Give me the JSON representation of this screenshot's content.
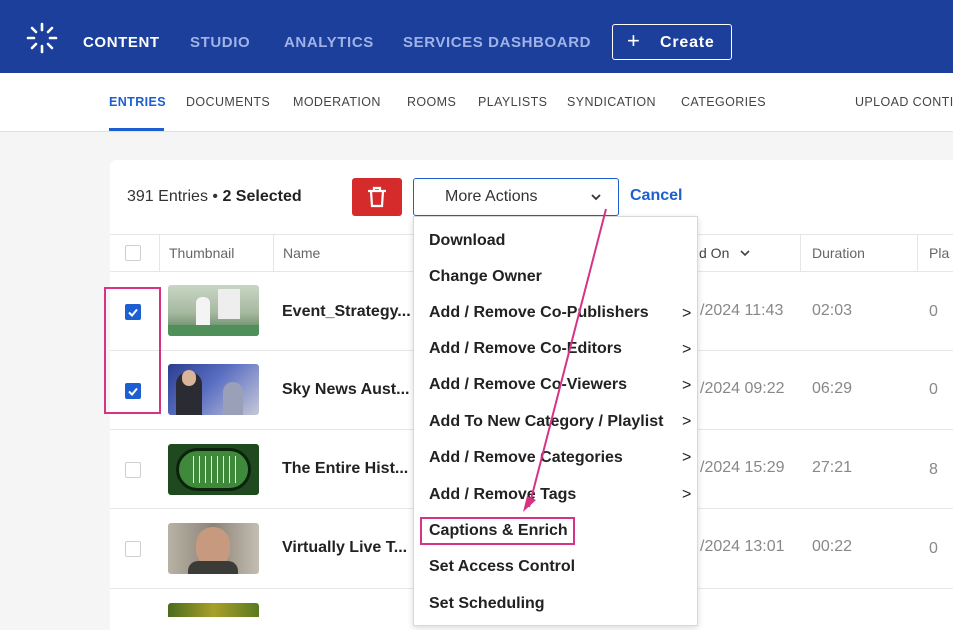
{
  "topnav": {
    "items": [
      "CONTENT",
      "STUDIO",
      "ANALYTICS",
      "SERVICES DASHBOARD"
    ],
    "active": "CONTENT",
    "create_label": "Create"
  },
  "subnav": {
    "items": [
      "ENTRIES",
      "DOCUMENTS",
      "MODERATION",
      "ROOMS",
      "PLAYLISTS",
      "SYNDICATION",
      "CATEGORIES"
    ],
    "active": "ENTRIES",
    "upload": "UPLOAD CONTI"
  },
  "toolbar": {
    "entries_count": "391 Entries",
    "bullet": "•",
    "selected": "2 Selected",
    "more_actions": "More Actions",
    "cancel": "Cancel"
  },
  "table": {
    "headers": {
      "thumbnail": "Thumbnail",
      "name": "Name",
      "date": "d On",
      "duration": "Duration",
      "plays": "Pla"
    },
    "rows": [
      {
        "name": "Event_Strategy...",
        "date": "/2024 11:43",
        "duration": "02:03",
        "plays": "0",
        "checked": true
      },
      {
        "name": "Sky News Aust...",
        "date": "/2024 09:22",
        "duration": "06:29",
        "plays": "0",
        "checked": true
      },
      {
        "name": "The Entire Hist...",
        "date": "/2024 15:29",
        "duration": "27:21",
        "plays": "8",
        "checked": false
      },
      {
        "name": "Virtually Live T...",
        "date": "/2024 13:01",
        "duration": "00:22",
        "plays": "0",
        "checked": false
      }
    ]
  },
  "menu": {
    "items": [
      {
        "label": "Download",
        "submenu": false
      },
      {
        "label": "Change Owner",
        "submenu": false
      },
      {
        "label": "Add / Remove Co-Publishers",
        "submenu": true
      },
      {
        "label": "Add / Remove Co-Editors",
        "submenu": true
      },
      {
        "label": "Add / Remove Co-Viewers",
        "submenu": true
      },
      {
        "label": "Add To New Category / Playlist",
        "submenu": true
      },
      {
        "label": "Add / Remove Categories",
        "submenu": true
      },
      {
        "label": "Add / Remove Tags",
        "submenu": true
      },
      {
        "label": "Captions & Enrich",
        "submenu": false
      },
      {
        "label": "Set Access Control",
        "submenu": false
      },
      {
        "label": "Set Scheduling",
        "submenu": false
      }
    ],
    "arrow_glyph": ">"
  },
  "colors": {
    "topbar": "#1c3f9c",
    "accent": "#1c5fd1",
    "delete": "#d52b2b",
    "annotation": "#d63384"
  }
}
